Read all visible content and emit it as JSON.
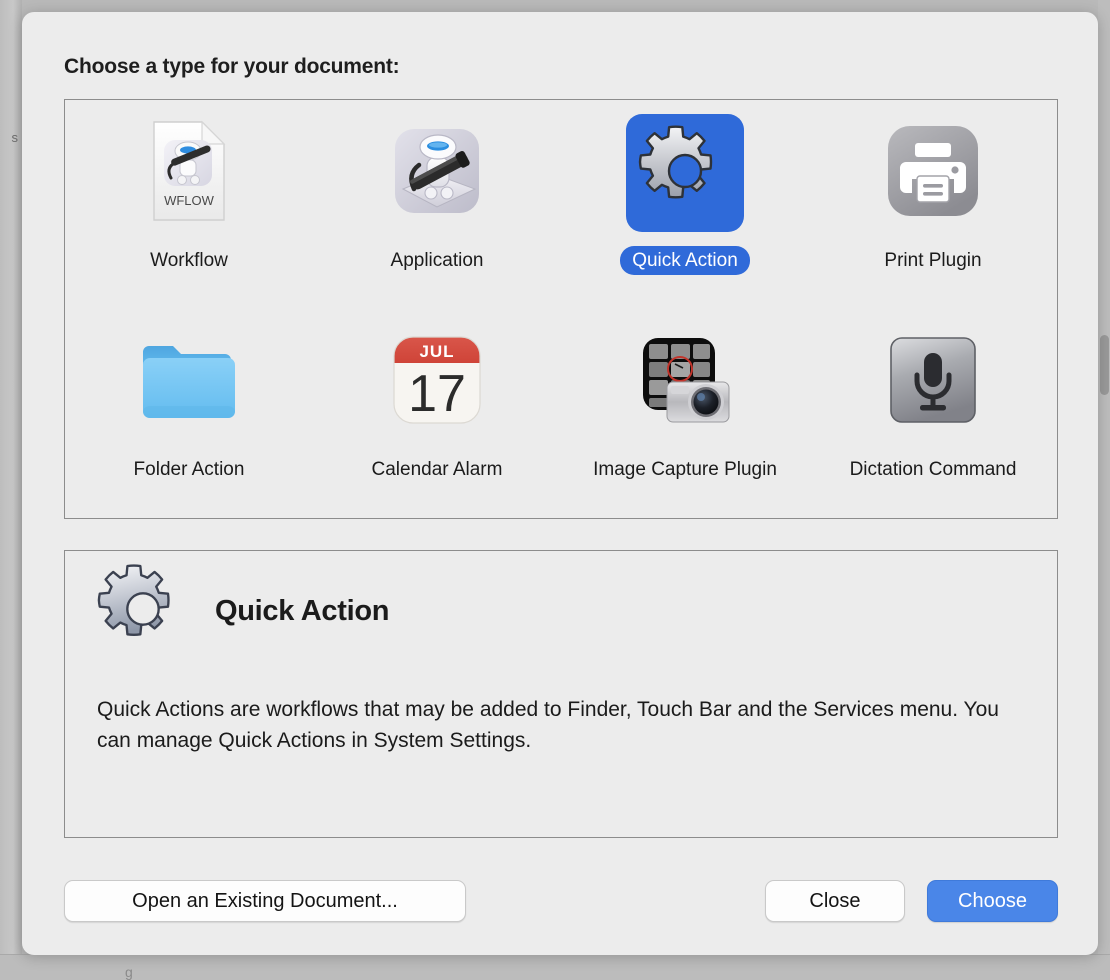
{
  "backdrop": {
    "left_edge_text": "s",
    "bottom_glyph": "g"
  },
  "dialog": {
    "prompt": "Choose a type for your document:",
    "types": [
      {
        "id": "workflow",
        "label": "Workflow",
        "icon": "workflow-document-icon",
        "badge": "WFLOW",
        "selected": false
      },
      {
        "id": "application",
        "label": "Application",
        "icon": "automator-application-icon",
        "selected": false
      },
      {
        "id": "quick-action",
        "label": "Quick Action",
        "icon": "gear-icon",
        "selected": true
      },
      {
        "id": "print-plugin",
        "label": "Print Plugin",
        "icon": "printer-icon",
        "selected": false
      },
      {
        "id": "folder-action",
        "label": "Folder Action",
        "icon": "folder-icon",
        "selected": false
      },
      {
        "id": "calendar-alarm",
        "label": "Calendar Alarm",
        "icon": "calendar-icon",
        "month": "JUL",
        "day": "17",
        "selected": false
      },
      {
        "id": "image-capture",
        "label": "Image Capture Plugin",
        "icon": "camera-grid-icon",
        "selected": false
      },
      {
        "id": "dictation",
        "label": "Dictation Command",
        "icon": "microphone-icon",
        "selected": false
      }
    ],
    "detail": {
      "icon": "gear-icon",
      "title": "Quick Action",
      "description": "Quick Actions are workflows that may be added to Finder, Touch Bar and the Services menu. You can manage Quick Actions in System Settings."
    },
    "buttons": {
      "open_existing": "Open an Existing Document...",
      "close": "Close",
      "choose": "Choose"
    }
  },
  "colors": {
    "selection_blue": "#2f6ad9",
    "default_button_blue": "#4a86e8",
    "dialog_background": "#ececec",
    "panel_border": "#8c8c8c",
    "calendar_red": "#d54b3d",
    "folder_blue": "#6fc0f0"
  }
}
